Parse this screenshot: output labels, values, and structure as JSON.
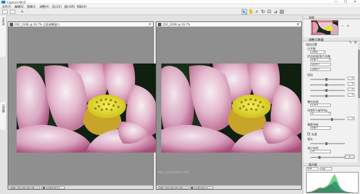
{
  "app": {
    "title": "Capture NX-D",
    "window_controls": [
      "—",
      "☐",
      "✕"
    ]
  },
  "menu": [
    "文件(F)",
    "编辑(E)",
    "图像(I)",
    "调整(A)",
    "显示(V)",
    "窗口(W)",
    "帮助(H)"
  ],
  "toolbar": {
    "tools": [
      "pointer-icon",
      "hand-icon",
      "zoom-icon",
      "rotate-icon",
      "crop-icon",
      "straighten-icon",
      "more-icon"
    ]
  },
  "left_tabs": {
    "top": "文件夹",
    "bottom": "过滤器"
  },
  "windows": [
    {
      "name": "DSC_0308 @ 16.7% 正面调整窗口",
      "status": [
        "RGB: 255,255,255 (ΔE:...)",
        "■ 显示图示警示 ▾"
      ]
    },
    {
      "name": "DSC_0308 @ 16.7%",
      "status": [
        "RGB: 255,255,255 (ΔE:...)",
        "■ 显示图示警示 ▾"
      ]
    }
  ],
  "watermark": "bbs.ylcamera.com",
  "right_panel": {
    "navigator_header": "导航",
    "adjust_header": "调整/元数据",
    "camera_settings": "相机设置",
    "white_balance_label": "白平衡",
    "white_balance_value": "记录值",
    "picture_control_label": "优化校准/照片风格",
    "picture_control_value": "标准_S",
    "sub_dropdowns": [
      "自然光 ▾",
      "基准值 ▾"
    ],
    "sharpen_label": "锐化",
    "value_boxes": [
      "0",
      "0",
      "0",
      "0"
    ],
    "exposure_label": "曝光补偿",
    "exposure_value": "0.00 ▾",
    "active_dlighting_label": "动态D-Lighting",
    "active_dlighting_value": "高",
    "vignette_label": "晕影控制",
    "vignette_value": "标准 ▾",
    "distortion_label": "失真",
    "distortion_value": "启用",
    "lens_label": "镜头",
    "noise_label": "减少杂色",
    "noise_value": "0 ▾",
    "histogram_header": "直方图",
    "histogram_channel": "RGB",
    "histogram_mode": "亮度",
    "histogram": {
      "red": [
        2,
        3,
        4,
        8,
        12,
        18,
        20,
        16,
        14,
        22,
        30,
        28,
        20,
        12,
        8,
        6,
        4,
        3,
        2,
        1,
        0,
        0,
        0
      ],
      "green": [
        1,
        2,
        3,
        6,
        10,
        14,
        16,
        18,
        22,
        28,
        40,
        58,
        70,
        52,
        26,
        12,
        6,
        3,
        2,
        1,
        0,
        0,
        0
      ],
      "blue": [
        1,
        2,
        3,
        5,
        9,
        12,
        14,
        14,
        18,
        22,
        26,
        34,
        42,
        36,
        20,
        12,
        6,
        3,
        2,
        1,
        0,
        0,
        0
      ],
      "lum": [
        1,
        2,
        3,
        6,
        10,
        14,
        16,
        18,
        20,
        24,
        30,
        36,
        44,
        40,
        24,
        14,
        8,
        4,
        2,
        1,
        0,
        0,
        0
      ]
    }
  },
  "colors": {
    "canvas": "#8f8f8f",
    "accent": "#2c7fd0"
  }
}
